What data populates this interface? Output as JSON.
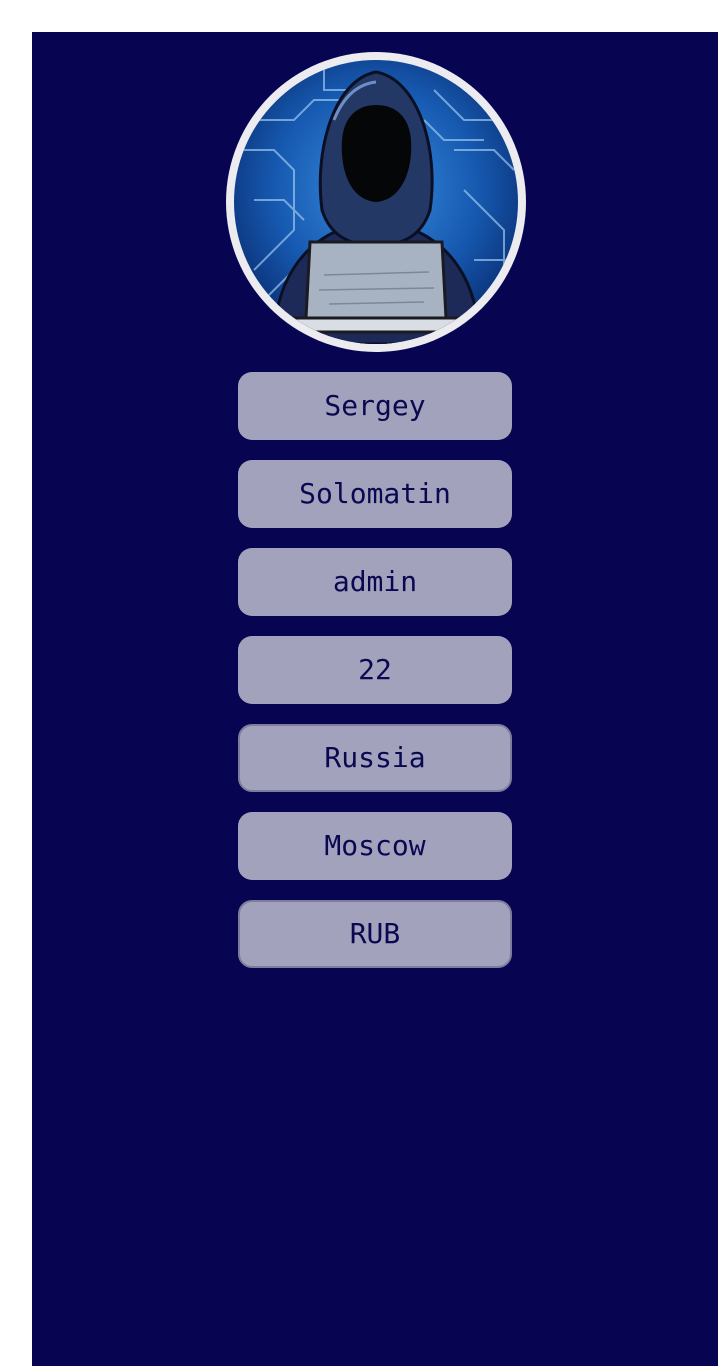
{
  "profile": {
    "first_name": "Sergey",
    "last_name": "Solomatin",
    "role": "admin",
    "age": "22",
    "country": "Russia",
    "city": "Moscow",
    "currency": "RUB"
  },
  "avatar": {
    "icon": "hooded-hacker-avatar"
  },
  "colors": {
    "page_background": "#ffffff",
    "panel_background": "#070452",
    "field_background": "#a3a2bc",
    "field_text": "#0a0850",
    "avatar_ring": "#ebebf0"
  }
}
